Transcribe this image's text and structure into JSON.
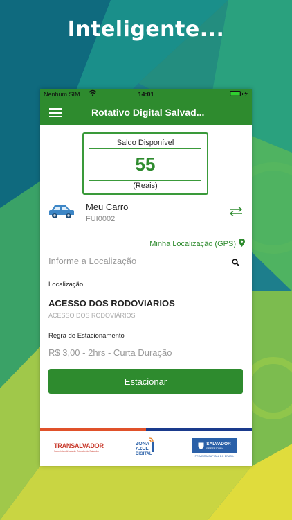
{
  "headline": "Inteligente...",
  "status_bar": {
    "carrier": "Nenhum SIM",
    "time": "14:01"
  },
  "app_bar": {
    "title": "Rotativo Digital Salvad..."
  },
  "balance": {
    "label": "Saldo Disponível",
    "value": "55",
    "unit": "(Reais)"
  },
  "vehicle": {
    "name": "Meu Carro",
    "plate": "FUI0002"
  },
  "gps_link": "Minha Localização (GPS)",
  "search": {
    "placeholder": "Informe a Localização"
  },
  "location": {
    "label": "Localização",
    "value": "ACESSO DOS RODOVIARIOS",
    "subtitle": "ACESSO DOS RODOVIÁRIOS"
  },
  "parking_rule": {
    "label": "Regra de Estacionamento",
    "value": "R$ 3,00 - 2hrs - Curta Duração"
  },
  "park_button": "Estacionar",
  "footer_logos": {
    "transalvador": "TRANSALVADOR",
    "transalvador_sub": "Superintendência de Trânsito de Salvador",
    "zona_azul": [
      "ZONA",
      "AZUL",
      "DIGITAL"
    ],
    "salvador": "SALVADOR",
    "salvador_sub": "PREFEITURA",
    "salvador_tagline": "PRIMEIRA CAPITAL DO BRASIL"
  },
  "colors": {
    "accent": "#2e8b2e",
    "stripe": [
      "#e0512a",
      "#1a3a8c"
    ]
  },
  "icons": [
    "menu-icon",
    "wifi-icon",
    "battery-icon",
    "car-icon",
    "swap-arrows-icon",
    "location-pin-icon",
    "search-icon"
  ]
}
